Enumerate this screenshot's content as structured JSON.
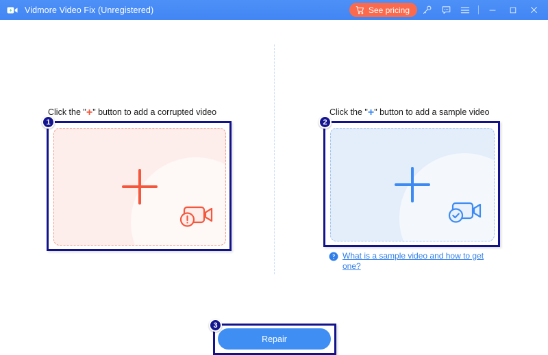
{
  "titlebar": {
    "app_name": "Vidmore Video Fix (Unregistered)",
    "logo_icon": "video-camera-logo-icon",
    "pricing_label": "See pricing",
    "cart_icon": "shopping-cart-icon",
    "key_icon": "key-icon",
    "feedback_icon": "speech-bubble-icon",
    "menu_icon": "hamburger-menu-icon",
    "minimize_icon": "minimize-icon",
    "maximize_icon": "maximize-icon",
    "close_icon": "close-icon",
    "bar_color": "#4286f4",
    "pricing_color": "#fb6a4d"
  },
  "left_panel": {
    "badge": "1",
    "heading_before": "Click the \"",
    "heading_plus": "+",
    "heading_after": "\" button to add a corrupted video",
    "plus_icon": "plus-icon",
    "video_icon": "video-camera-warning-icon",
    "accent_color": "#f4573c",
    "fill_color": "#fdeeec"
  },
  "right_panel": {
    "badge": "2",
    "heading_before": "Click the \"",
    "heading_plus": "+",
    "heading_after": "\" button to add a sample video",
    "plus_icon": "plus-icon",
    "video_icon": "video-camera-check-icon",
    "accent_color": "#3d8bf2",
    "fill_color": "#e4eefb",
    "help_icon": "question-mark-icon",
    "help_text": "What is a sample video and how to get one?"
  },
  "repair": {
    "badge": "3",
    "label": "Repair",
    "color": "#3e8ef4"
  }
}
